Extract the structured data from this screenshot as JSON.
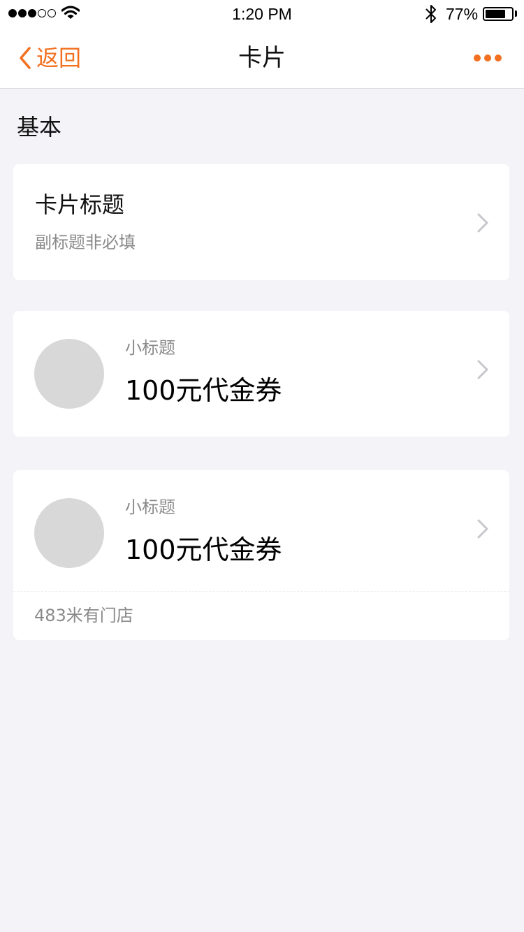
{
  "status_bar": {
    "signal_dots_filled": 3,
    "signal_dots_total": 5,
    "time": "1:20 PM",
    "battery_percent_label": "77%",
    "battery_level": 0.77
  },
  "nav": {
    "back_label": "返回",
    "title": "卡片",
    "accent_color": "#f2701f",
    "icons": [
      "chevron-left-icon",
      "more-dots-icon"
    ]
  },
  "section": {
    "title": "基本"
  },
  "cards": [
    {
      "title": "卡片标题",
      "subtitle": "副标题非必填"
    },
    {
      "small_title": "小标题",
      "main_text": "100元代金券"
    },
    {
      "small_title": "小标题",
      "main_text": "100元代金券",
      "footer": "483米有门店"
    }
  ]
}
